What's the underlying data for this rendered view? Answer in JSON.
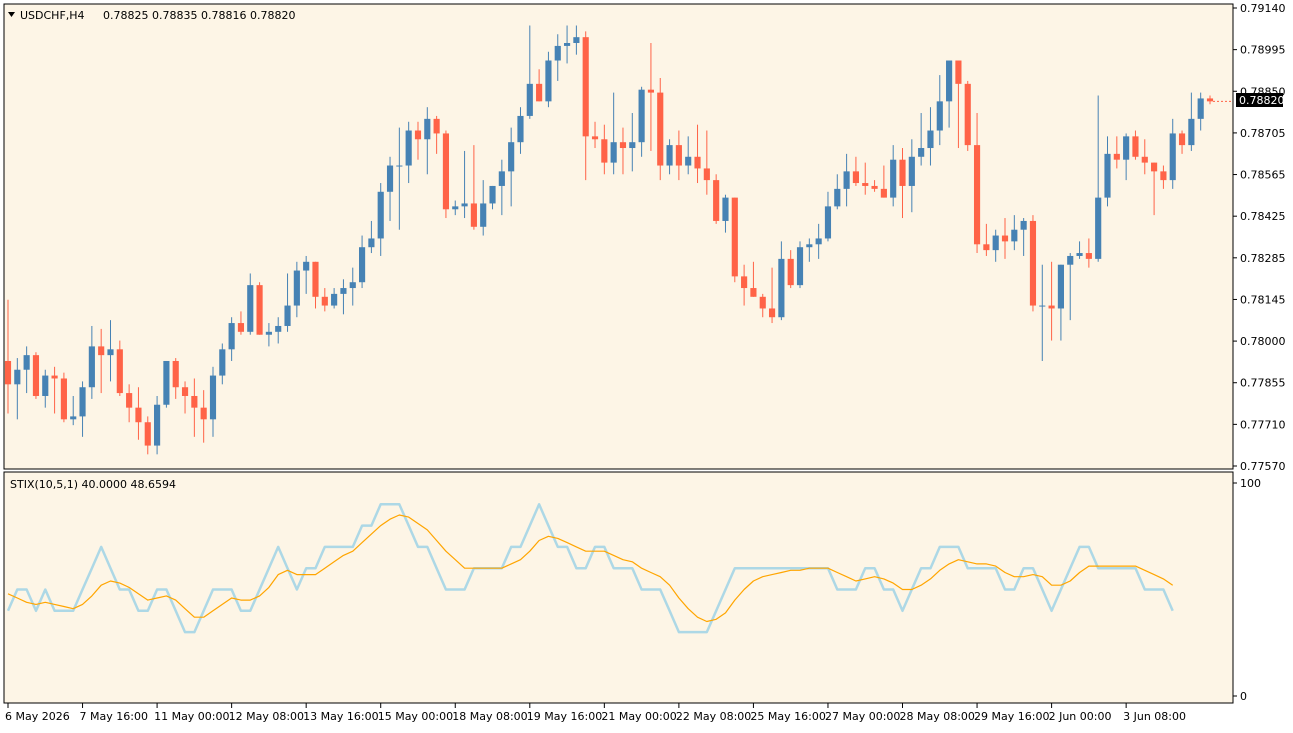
{
  "colors": {
    "background": "#fdf5e6",
    "frame": "#000000",
    "bull": "#4682b4",
    "bear": "#ff6347",
    "wick_bull": "#4682b4",
    "wick_bear": "#ff6347",
    "stix_main": "#add8e6",
    "stix_signal": "#ffa500",
    "price_tag_bg": "#000000",
    "price_tag_fg": "#ffffff"
  },
  "header": {
    "symbol_label": "USDCHF,H4",
    "ohlc_label": "0.78825 0.78835 0.78816 0.78820"
  },
  "indicator_header": {
    "label": "STIX(10,5,1) 40.0000 48.6594"
  },
  "current_price": "0.78820",
  "chart_data": [
    {
      "type": "candlestick",
      "symbol": "USDCHF",
      "timeframe": "H4",
      "ylim": [
        0.7757,
        0.7914
      ],
      "y_ticks": [
        "0.79140",
        "0.78995",
        "0.78850",
        "0.78705",
        "0.78565",
        "0.78425",
        "0.78285",
        "0.78145",
        "0.78000",
        "0.77855",
        "0.77710",
        "0.77570"
      ],
      "x_ticks": [
        {
          "label": "6 May 2026",
          "index": 0
        },
        {
          "label": "7 May 16:00",
          "index": 8
        },
        {
          "label": "11 May 00:00",
          "index": 16
        },
        {
          "label": "12 May 08:00",
          "index": 24
        },
        {
          "label": "13 May 16:00",
          "index": 32
        },
        {
          "label": "15 May 00:00",
          "index": 40
        },
        {
          "label": "18 May 08:00",
          "index": 48
        },
        {
          "label": "19 May 16:00",
          "index": 56
        },
        {
          "label": "21 May 00:00",
          "index": 64
        },
        {
          "label": "22 May 08:00",
          "index": 72
        },
        {
          "label": "25 May 16:00",
          "index": 80
        },
        {
          "label": "27 May 00:00",
          "index": 88
        },
        {
          "label": "28 May 08:00",
          "index": 96
        },
        {
          "label": "29 May 16:00",
          "index": 104
        },
        {
          "label": "2 Jun 00:00",
          "index": 112
        },
        {
          "label": "3 Jun 08:00",
          "index": 120
        }
      ],
      "candles": [
        [
          0.7793,
          0.7814,
          0.7775,
          0.7785
        ],
        [
          0.7785,
          0.7794,
          0.7773,
          0.779
        ],
        [
          0.779,
          0.7798,
          0.7782,
          0.7795
        ],
        [
          0.7795,
          0.7796,
          0.778,
          0.7781
        ],
        [
          0.7781,
          0.779,
          0.7777,
          0.7788
        ],
        [
          0.7788,
          0.7791,
          0.7775,
          0.7787
        ],
        [
          0.7787,
          0.7789,
          0.7772,
          0.7773
        ],
        [
          0.7773,
          0.7781,
          0.7771,
          0.7774
        ],
        [
          0.7774,
          0.7786,
          0.7767,
          0.7784
        ],
        [
          0.7784,
          0.7805,
          0.778,
          0.7798
        ],
        [
          0.7798,
          0.7804,
          0.7782,
          0.7795
        ],
        [
          0.7795,
          0.7807,
          0.7786,
          0.7797
        ],
        [
          0.7797,
          0.78,
          0.7781,
          0.7782
        ],
        [
          0.7782,
          0.7785,
          0.7772,
          0.7777
        ],
        [
          0.7777,
          0.7784,
          0.7766,
          0.7772
        ],
        [
          0.7772,
          0.7774,
          0.7761,
          0.7764
        ],
        [
          0.7764,
          0.7781,
          0.7761,
          0.7778
        ],
        [
          0.7778,
          0.7793,
          0.7777,
          0.7793
        ],
        [
          0.7793,
          0.7794,
          0.778,
          0.7784
        ],
        [
          0.7784,
          0.7786,
          0.7775,
          0.7781
        ],
        [
          0.7781,
          0.7787,
          0.7767,
          0.7777
        ],
        [
          0.7777,
          0.7783,
          0.7765,
          0.7773
        ],
        [
          0.7773,
          0.7791,
          0.7767,
          0.7788
        ],
        [
          0.7788,
          0.7799,
          0.7785,
          0.7797
        ],
        [
          0.7797,
          0.7808,
          0.7793,
          0.7806
        ],
        [
          0.7806,
          0.781,
          0.7802,
          0.7803
        ],
        [
          0.7803,
          0.7823,
          0.7802,
          0.7819
        ],
        [
          0.7819,
          0.782,
          0.7802,
          0.7802
        ],
        [
          0.7802,
          0.7806,
          0.7798,
          0.7803
        ],
        [
          0.7803,
          0.7808,
          0.7799,
          0.7805
        ],
        [
          0.7805,
          0.7823,
          0.7803,
          0.7812
        ],
        [
          0.7812,
          0.7827,
          0.7808,
          0.7824
        ],
        [
          0.7824,
          0.7829,
          0.7816,
          0.7827
        ],
        [
          0.7827,
          0.7827,
          0.7811,
          0.7815
        ],
        [
          0.7815,
          0.7818,
          0.781,
          0.7812
        ],
        [
          0.7812,
          0.7818,
          0.7811,
          0.7816
        ],
        [
          0.7816,
          0.7821,
          0.7809,
          0.7818
        ],
        [
          0.7818,
          0.7825,
          0.7812,
          0.782
        ],
        [
          0.782,
          0.7836,
          0.7818,
          0.7832
        ],
        [
          0.7832,
          0.7841,
          0.783,
          0.7835
        ],
        [
          0.7835,
          0.7854,
          0.7829,
          0.7851
        ],
        [
          0.7851,
          0.7863,
          0.7841,
          0.786
        ],
        [
          0.786,
          0.7873,
          0.7838,
          0.786
        ],
        [
          0.786,
          0.7875,
          0.7854,
          0.7872
        ],
        [
          0.7872,
          0.7875,
          0.7862,
          0.7869
        ],
        [
          0.7869,
          0.788,
          0.7857,
          0.7876
        ],
        [
          0.7876,
          0.7877,
          0.7864,
          0.7871
        ],
        [
          0.7871,
          0.7872,
          0.7842,
          0.7845
        ],
        [
          0.7845,
          0.7848,
          0.7843,
          0.7846
        ],
        [
          0.7846,
          0.7865,
          0.7842,
          0.7847
        ],
        [
          0.7847,
          0.7867,
          0.7838,
          0.7839
        ],
        [
          0.7839,
          0.7855,
          0.7836,
          0.7847
        ],
        [
          0.7847,
          0.7853,
          0.7845,
          0.7853
        ],
        [
          0.7853,
          0.7862,
          0.7843,
          0.7858
        ],
        [
          0.7858,
          0.7873,
          0.7846,
          0.7868
        ],
        [
          0.7868,
          0.788,
          0.7864,
          0.7877
        ],
        [
          0.7877,
          0.7908,
          0.7876,
          0.7888
        ],
        [
          0.7888,
          0.7893,
          0.7883,
          0.7882
        ],
        [
          0.7882,
          0.7899,
          0.788,
          0.7896
        ],
        [
          0.7896,
          0.7905,
          0.7889,
          0.7901
        ],
        [
          0.7901,
          0.7908,
          0.7895,
          0.7902
        ],
        [
          0.7902,
          0.7908,
          0.7898,
          0.7904
        ],
        [
          0.7904,
          0.7906,
          0.7855,
          0.787
        ],
        [
          0.787,
          0.7875,
          0.7866,
          0.7869
        ],
        [
          0.7869,
          0.7874,
          0.7857,
          0.7861
        ],
        [
          0.7861,
          0.7885,
          0.7857,
          0.7868
        ],
        [
          0.7868,
          0.7873,
          0.7857,
          0.7866
        ],
        [
          0.7866,
          0.7878,
          0.7858,
          0.7868
        ],
        [
          0.7868,
          0.7887,
          0.7863,
          0.7886
        ],
        [
          0.7886,
          0.7902,
          0.7865,
          0.7885
        ],
        [
          0.7885,
          0.789,
          0.7855,
          0.786
        ],
        [
          0.786,
          0.7869,
          0.7857,
          0.7867
        ],
        [
          0.7867,
          0.7872,
          0.7855,
          0.786
        ],
        [
          0.786,
          0.787,
          0.7857,
          0.7863
        ],
        [
          0.7863,
          0.7874,
          0.7854,
          0.7859
        ],
        [
          0.7859,
          0.7872,
          0.785,
          0.7855
        ],
        [
          0.7855,
          0.7857,
          0.784,
          0.7841
        ],
        [
          0.7841,
          0.785,
          0.7837,
          0.7849
        ],
        [
          0.7849,
          0.7836,
          0.782,
          0.7822
        ],
        [
          0.7822,
          0.7826,
          0.7812,
          0.7818
        ],
        [
          0.7818,
          0.7827,
          0.7815,
          0.7815
        ],
        [
          0.7815,
          0.7816,
          0.7808,
          0.7811
        ],
        [
          0.7811,
          0.7825,
          0.7806,
          0.7808
        ],
        [
          0.7808,
          0.7834,
          0.7807,
          0.7828
        ],
        [
          0.7828,
          0.7831,
          0.7818,
          0.7819
        ],
        [
          0.7819,
          0.7834,
          0.7818,
          0.7832
        ],
        [
          0.7832,
          0.7835,
          0.7827,
          0.7833
        ],
        [
          0.7833,
          0.784,
          0.7828,
          0.7835
        ],
        [
          0.7835,
          0.7851,
          0.7834,
          0.7846
        ],
        [
          0.7846,
          0.7857,
          0.7845,
          0.7852
        ],
        [
          0.7852,
          0.7864,
          0.7846,
          0.7858
        ],
        [
          0.7858,
          0.7863,
          0.7853,
          0.7854
        ],
        [
          0.7854,
          0.7861,
          0.785,
          0.7853
        ],
        [
          0.7853,
          0.7855,
          0.7851,
          0.7852
        ],
        [
          0.7852,
          0.786,
          0.785,
          0.7849
        ],
        [
          0.7849,
          0.7867,
          0.7846,
          0.7862
        ],
        [
          0.7862,
          0.7866,
          0.7842,
          0.7853
        ],
        [
          0.7853,
          0.7869,
          0.7844,
          0.7863
        ],
        [
          0.7863,
          0.7878,
          0.786,
          0.7866
        ],
        [
          0.7866,
          0.788,
          0.786,
          0.7872
        ],
        [
          0.7872,
          0.7891,
          0.7867,
          0.7882
        ],
        [
          0.7882,
          0.7891,
          0.7873,
          0.7896
        ],
        [
          0.7896,
          0.7896,
          0.7866,
          0.7888
        ],
        [
          0.7888,
          0.7889,
          0.7865,
          0.7867
        ],
        [
          0.7867,
          0.7878,
          0.783,
          0.7833
        ],
        [
          0.7833,
          0.784,
          0.7829,
          0.7831
        ],
        [
          0.7831,
          0.7838,
          0.7827,
          0.7836
        ],
        [
          0.7836,
          0.7842,
          0.7828,
          0.7834
        ],
        [
          0.7834,
          0.7843,
          0.7831,
          0.7838
        ],
        [
          0.7838,
          0.7842,
          0.7829,
          0.7841
        ],
        [
          0.7841,
          0.7843,
          0.781,
          0.7812
        ],
        [
          0.7812,
          0.7826,
          0.7793,
          0.7812
        ],
        [
          0.7812,
          0.7827,
          0.78,
          0.7811
        ],
        [
          0.7811,
          0.7825,
          0.78,
          0.7826
        ],
        [
          0.7826,
          0.783,
          0.7807,
          0.7829
        ],
        [
          0.7829,
          0.7834,
          0.7828,
          0.783
        ],
        [
          0.783,
          0.7835,
          0.7825,
          0.7828
        ],
        [
          0.7828,
          0.7884,
          0.7827,
          0.7849
        ],
        [
          0.7849,
          0.787,
          0.7846,
          0.7864
        ],
        [
          0.7864,
          0.787,
          0.7859,
          0.7862
        ],
        [
          0.7862,
          0.7871,
          0.7855,
          0.787
        ],
        [
          0.787,
          0.7872,
          0.7862,
          0.7863
        ],
        [
          0.7863,
          0.7869,
          0.7857,
          0.7861
        ],
        [
          0.7861,
          0.786,
          0.7843,
          0.7858
        ],
        [
          0.7858,
          0.786,
          0.7852,
          0.7855
        ],
        [
          0.7855,
          0.7876,
          0.7852,
          0.7871
        ],
        [
          0.7871,
          0.7872,
          0.7864,
          0.7867
        ],
        [
          0.7867,
          0.7885,
          0.7865,
          0.7876
        ],
        [
          0.7876,
          0.7885,
          0.7872,
          0.7883
        ],
        [
          0.7883,
          0.7884,
          0.7881,
          0.7882
        ]
      ]
    },
    {
      "type": "line",
      "indicator": "STIX(10,5,1)",
      "ylim": [
        0,
        100
      ],
      "y_ticks": [
        "100",
        "0"
      ],
      "series": [
        {
          "color_key": "stix_main",
          "values": [
            40,
            50,
            50,
            40,
            50,
            40,
            40,
            40,
            50,
            60,
            70,
            60,
            50,
            50,
            40,
            40,
            50,
            50,
            40,
            30,
            30,
            40,
            50,
            50,
            50,
            40,
            40,
            50,
            60,
            70,
            60,
            50,
            60,
            60,
            70,
            70,
            70,
            70,
            80,
            80,
            90,
            90,
            90,
            80,
            70,
            70,
            60,
            50,
            50,
            50,
            60,
            60,
            60,
            60,
            70,
            70,
            80,
            90,
            80,
            70,
            70,
            60,
            60,
            70,
            70,
            60,
            60,
            60,
            50,
            50,
            50,
            40,
            30,
            30,
            30,
            30,
            40,
            50,
            60,
            60,
            60,
            60,
            60,
            60,
            60,
            60,
            60,
            60,
            60,
            50,
            50,
            50,
            60,
            60,
            50,
            50,
            40,
            50,
            60,
            60,
            70,
            70,
            70,
            60,
            60,
            60,
            60,
            50,
            50,
            60,
            60,
            50,
            40,
            50,
            60,
            70,
            70,
            60,
            60,
            60,
            60,
            60,
            50,
            50,
            50,
            40
          ]
        },
        {
          "color_key": "stix_signal",
          "values": [
            48,
            46,
            44,
            43,
            44,
            43,
            42,
            41,
            43,
            47,
            52,
            54,
            53,
            51,
            48,
            45,
            46,
            47,
            45,
            41,
            37,
            37,
            40,
            43,
            46,
            45,
            45,
            47,
            51,
            57,
            59,
            57,
            57,
            57,
            60,
            63,
            66,
            68,
            72,
            76,
            80,
            83,
            85,
            84,
            81,
            78,
            73,
            68,
            64,
            60,
            60,
            60,
            60,
            60,
            62,
            64,
            68,
            73,
            75,
            74,
            72,
            70,
            68,
            68,
            68,
            66,
            64,
            63,
            60,
            58,
            56,
            52,
            46,
            41,
            37,
            35,
            36,
            39,
            45,
            50,
            54,
            56,
            57,
            58,
            59,
            59,
            60,
            60,
            60,
            58,
            56,
            54,
            55,
            56,
            55,
            53,
            50,
            50,
            52,
            55,
            59,
            62,
            64,
            63,
            62,
            62,
            61,
            58,
            56,
            56,
            57,
            56,
            52,
            52,
            54,
            58,
            61,
            61,
            61,
            61,
            61,
            61,
            59,
            57,
            55,
            52
          ]
        }
      ]
    }
  ]
}
